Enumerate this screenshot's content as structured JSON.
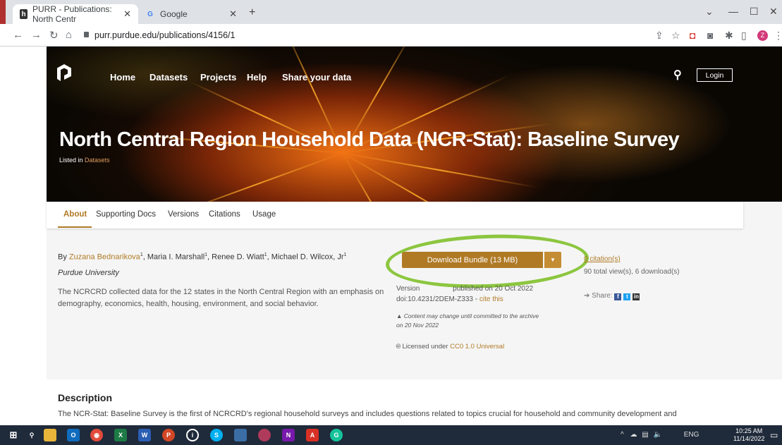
{
  "browser": {
    "tabs": [
      {
        "label": "PURR - Publications: North Centr",
        "active": true
      },
      {
        "label": "Google",
        "active": false
      }
    ],
    "url": "purr.purdue.edu/publications/4156/1"
  },
  "site": {
    "nav": [
      "Home",
      "Datasets",
      "Projects",
      "Help",
      "Share your data"
    ],
    "login_label": "Login"
  },
  "publication": {
    "title": "North Central Region Household Data (NCR-Stat): Baseline Survey",
    "listed_in_prefix": "Listed in",
    "listed_in_link": "Datasets",
    "tabs": [
      "About",
      "Supporting Docs",
      "Versions",
      "Citations",
      "Usage"
    ],
    "authors_prefix": "By",
    "authors": [
      {
        "name": "Zuzana Bednarikova",
        "sup": "1"
      },
      {
        "name": "Maria I. Marshall",
        "sup": "1"
      },
      {
        "name": "Renee D. Wiatt",
        "sup": "1"
      },
      {
        "name": "Michael D. Wilcox, Jr",
        "sup": "1"
      }
    ],
    "affiliation": "Purdue University",
    "abstract": "The NCRCRD collected data for the 12 states in the North Central Region with an emphasis on demography, economics, health, housing, environment, and social behavior.",
    "download_label": "Download Bundle (13 MB)",
    "version_prefix": "Version",
    "version_suffix": "published on 20 Oct 2022",
    "doi": "doi:10.4231/2DEM-Z333",
    "cite_this": "cite this",
    "warning": "Content may change until committed to the archive on 20 Nov 2022",
    "license_prefix": "Licensed under",
    "license": "CC0 1.0 Universal",
    "citations": "0 citation(s)",
    "views": "90 total view(s), 6 download(s)",
    "share_label": "Share:",
    "description_heading": "Description",
    "description": "The NCR-Stat: Baseline Survey is the first of NCRCRD's regional household surveys and includes questions related to topics crucial for household and community development and"
  },
  "taskbar": {
    "language": "ENG",
    "time": "10:25 AM",
    "date": "11/14/2022"
  },
  "colors": {
    "accent": "#b07a25",
    "highlight": "#8cc63f"
  }
}
